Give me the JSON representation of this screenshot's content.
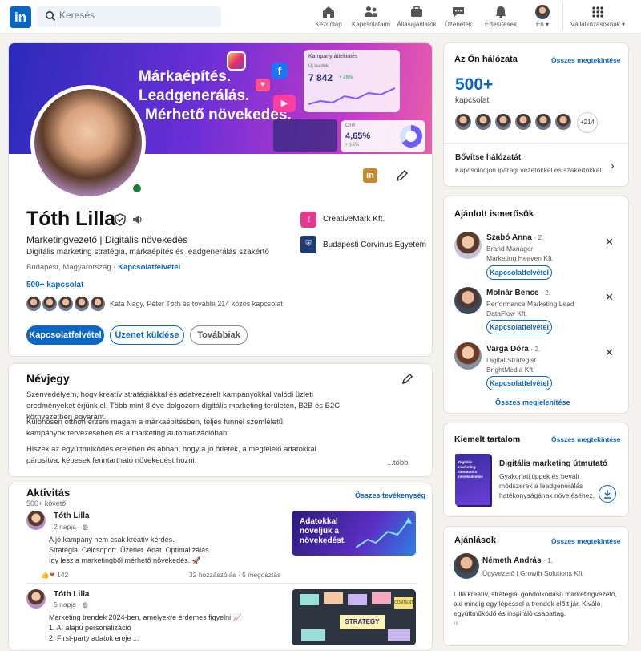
{
  "nav": {
    "logo": "in",
    "search_placeholder": "Keresés",
    "items": [
      {
        "label": "Kezdőlap",
        "icon": "home-icon"
      },
      {
        "label": "Kapcsolataim",
        "icon": "network-icon"
      },
      {
        "label": "Állásajánlatok",
        "icon": "jobs-icon"
      },
      {
        "label": "Üzenetek",
        "icon": "messaging-icon"
      },
      {
        "label": "Értesítések",
        "icon": "notifications-icon"
      },
      {
        "label": "Én",
        "icon": "me-avatar"
      },
      {
        "label": "Vállalkozásoknak",
        "icon": "grid-icon"
      }
    ]
  },
  "banner": {
    "lines": [
      "Márkaépítés.",
      "Leadgenerálás.",
      "Mérhető növekedés."
    ],
    "widget1_title": "Kampány áttekintés",
    "widget1_sub": "Új leadek",
    "widget1_value": "7 842",
    "widget1_delta": "+ 28%",
    "widget2_label": "CTR",
    "widget2_value": "4,65%",
    "widget2_delta": "+ 16%"
  },
  "profile": {
    "name": "Tóth Lilla",
    "headline": "Marketingvezető | Digitális növekedés",
    "subheadline": "Digitális marketing stratégia, márkaépítés és leadgenerálás szakértő",
    "location": "Budapest, Magyarország",
    "separator": "·",
    "contact_link": "Kapcsolatfelvétel",
    "connections": "500+ kapcsolat",
    "mutual": "Kata Nagy, Péter Tóth és további 214 közös kapcsolat",
    "company": "CreativeMark Kft.",
    "school": "Budapesti Corvinus Egyetem",
    "btn_connect": "Kapcsolatfelvétel",
    "btn_message": "Üzenet küldése",
    "btn_more": "Továbbiak"
  },
  "about": {
    "title": "Névjegy",
    "p1": "Szenvedélyem, hogy kreatív stratégiákkal és adatvezérelt kampányokkal valódi üzleti eredményeket érjünk el. Több mint 8 éve dolgozom digitális marketing területén, B2B és B2C környezetben egyaránt.",
    "p2": "Különösen otthon érzem magam a márkaépítésben, teljes funnel szemléletű kampányok tervezésében és a marketing automatizációban.",
    "p3": "Hiszek az együttműködés erejében és abban, hogy a jó ötletek, a megfelelő adatokkal párosítva, képesek fenntartható növekedést hozni.",
    "more": "...több"
  },
  "activity": {
    "title": "Aktivitás",
    "followers": "500+ követő",
    "all_link": "Összes tevékenység",
    "posts": [
      {
        "author": "Tóth Lilla",
        "time": "2 napja",
        "dot": "·",
        "lines": [
          "A jó kampány nem csak kreatív kérdés.",
          "Stratégia. Célcsoport. Üzenet. Adat. Optimalizálás.",
          "Így lesz a marketingből mérhető növekedés. 🚀"
        ],
        "reactions": "142",
        "comments": "32 hozzászólás",
        "shares": "5 megosztás",
        "image_text": "Adatokkal növeljük a növekedést."
      },
      {
        "author": "Tóth Lilla",
        "time": "5 napja",
        "dot": "·",
        "lines": [
          "Marketing trendek 2024-ben, amelyekre érdemes figyelni 📈",
          "1. AI alapú personalizáció",
          "2. First-party adatok ereje ..."
        ],
        "image_text": "STRATEGY",
        "image_note": "CONTENT"
      }
    ]
  },
  "network": {
    "title": "Az Ön hálózata",
    "all_link": "Összes megtekintése",
    "count": "500+",
    "count_label": "kapcsolat",
    "extra": "+214",
    "expand_title": "Bővítse hálózatát",
    "expand_sub": "Kapcsolódjon iparági vezetőkkel és szakértőkkel"
  },
  "suggested": {
    "title": "Ajánlott ismerősök",
    "people": [
      {
        "name": "Szabó Anna",
        "degree": "· 2.",
        "role": "Brand Manager",
        "company": "Marketing Heaven Kft.",
        "action": "Kapcsolatfelvétel"
      },
      {
        "name": "Molnár Bence",
        "degree": "· 2.",
        "role": "Performance Marketing Lead",
        "company": "DataFlow Kft.",
        "action": "Kapcsolatfelvétel"
      },
      {
        "name": "Varga Dóra",
        "degree": "· 2.",
        "role": "Digital Strategist",
        "company": "BrightMedia Kft.",
        "action": "Kapcsolatfelvétel"
      }
    ],
    "show_all": "Összes megjelenítése"
  },
  "featured": {
    "title": "Kiemelt tartalom",
    "all_link": "Összes megtekintése",
    "book_text": "Digitális marketing útmutató a növekedéshez",
    "item_title": "Digitális marketing útmutató",
    "item_desc": "Gyakorlati tippek és bevált módszerek a leadgenerálás hatékonyságának növeléséhez."
  },
  "recommendations": {
    "title": "Ajánlások",
    "all_link": "Összes megtekintése",
    "name": "Németh András",
    "degree": "· 1.",
    "role": "Ügyvezető | Growth Solutions Kft.",
    "text": "Lilla kreatív, stratégiai gondolkodású marketingvezető, aki mindig egy lépéssel a trendek előtt jár. Kiváló együttműködő és inspiráló csapattag.",
    "quote": "“"
  },
  "colors": {
    "brand": "#0a66c2",
    "online": "#1c7c35",
    "background": "#f3f2ef"
  }
}
